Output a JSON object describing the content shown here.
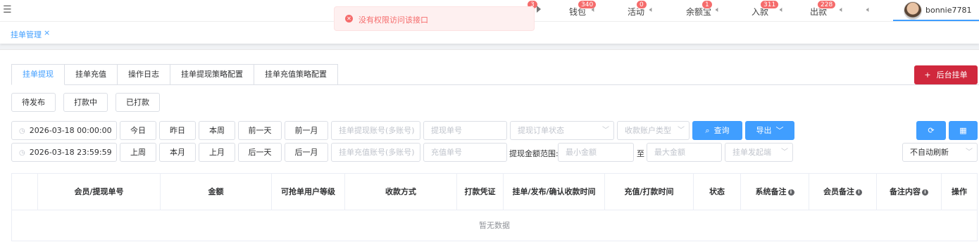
{
  "topbar": {
    "menu_icon": "menu-icon",
    "notifications": [
      {
        "label": "钱包",
        "badge": "340"
      },
      {
        "label": "活动",
        "badge": "0"
      },
      {
        "label": "余额宝",
        "badge": "1"
      },
      {
        "label": "入款",
        "badge": "311"
      },
      {
        "label": "出款",
        "badge": "228"
      },
      {
        "label": "",
        "badge": ""
      }
    ],
    "hidden_badge": "3",
    "username": "bonnie7781"
  },
  "page_tab": {
    "label": "挂单管理",
    "close": "×"
  },
  "toast": {
    "text": "没有权限访问该接口",
    "icon": "close-circle-icon",
    "color": "#f56c6c"
  },
  "tabs": [
    {
      "label": "挂单提现",
      "active": true
    },
    {
      "label": "挂单充值",
      "active": false
    },
    {
      "label": "操作日志",
      "active": false
    },
    {
      "label": "挂单提现策略配置",
      "active": false
    },
    {
      "label": "挂单充值策略配置",
      "active": false
    }
  ],
  "add_button": {
    "label": "后台挂单",
    "icon": "+",
    "color": "#d0283d"
  },
  "status_buttons": [
    "待发布",
    "打款中",
    "已打款"
  ],
  "filters": {
    "start_time": "2026-03-18 00:00:00",
    "end_time": "2026-03-18 23:59:59",
    "quick_row1": [
      "今日",
      "昨日",
      "本周",
      "前一天",
      "前一月"
    ],
    "quick_row2": [
      "上周",
      "本月",
      "上月",
      "后一天",
      "后一月"
    ],
    "withdraw_account_placeholder": "挂单提现账号(多账号)",
    "withdraw_no_placeholder": "提现单号",
    "order_status_placeholder": "提现订单状态",
    "account_type_placeholder": "收款账户类型",
    "recharge_account_placeholder": "挂单充值账号(多账号)",
    "recharge_no_placeholder": "充值单号",
    "amount_range_label": "提现金额范围:",
    "min_amount_placeholder": "最小金额",
    "range_to": "至",
    "max_amount_placeholder": "最大金额",
    "origin_placeholder": "挂单发起端",
    "search_label": "查询",
    "export_label": "导出",
    "auto_refresh": "不自动刷新"
  },
  "table": {
    "columns": [
      {
        "label": "",
        "info": false
      },
      {
        "label": "会员/提现单号",
        "info": false
      },
      {
        "label": "金额",
        "info": false
      },
      {
        "label": "可抢单用户等级",
        "info": false
      },
      {
        "label": "收款方式",
        "info": false
      },
      {
        "label": "打款凭证",
        "info": false
      },
      {
        "label": "挂单/发布/确认收款时间",
        "info": false
      },
      {
        "label": "充值/打款时间",
        "info": false
      },
      {
        "label": "状态",
        "info": false
      },
      {
        "label": "系统备注",
        "info": true
      },
      {
        "label": "会员备注",
        "info": true
      },
      {
        "label": "备注内容",
        "info": true
      },
      {
        "label": "操作",
        "info": false
      }
    ],
    "empty_text": "暂无数据"
  }
}
